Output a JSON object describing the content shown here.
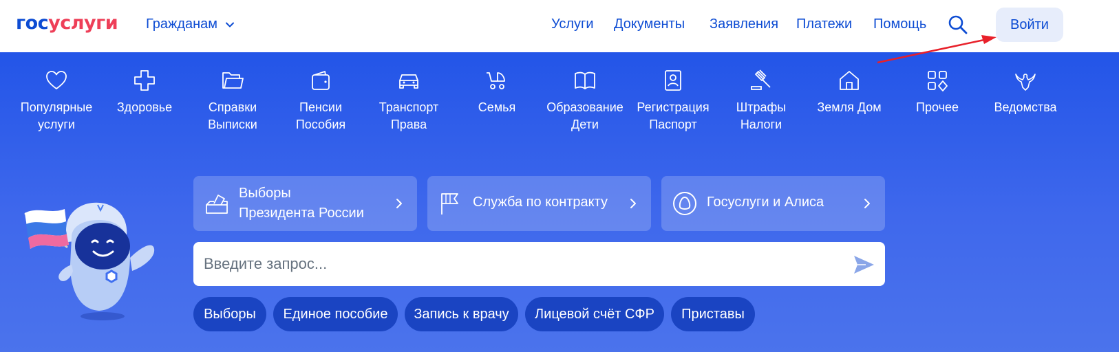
{
  "header": {
    "logo_part1": "гос",
    "logo_part2": "услуги",
    "audience": "Гражданам",
    "nav": [
      "Услуги",
      "Документы",
      "Заявления",
      "Платежи",
      "Помощь"
    ],
    "login": "Войти"
  },
  "categories": [
    {
      "label": "Популярные\nуслуги",
      "icon": "heart-icon"
    },
    {
      "label": "Здоровье",
      "icon": "cross-icon"
    },
    {
      "label": "Справки\nВыписки",
      "icon": "folder-icon"
    },
    {
      "label": "Пенсии\nПособия",
      "icon": "wallet-icon"
    },
    {
      "label": "Транспорт\nПрава",
      "icon": "car-icon"
    },
    {
      "label": "Семья",
      "icon": "stroller-icon"
    },
    {
      "label": "Образование\nДети",
      "icon": "book-icon"
    },
    {
      "label": "Регистрация\nПаспорт",
      "icon": "id-card-icon"
    },
    {
      "label": "Штрафы\nНалоги",
      "icon": "gavel-icon"
    },
    {
      "label": "Земля Дом",
      "icon": "house-icon"
    },
    {
      "label": "Прочее",
      "icon": "grid-icon"
    },
    {
      "label": "Ведомства",
      "icon": "eagle-icon"
    }
  ],
  "promos": [
    {
      "label": "Выборы\nПрезидента России",
      "icon": "ballot-box-icon"
    },
    {
      "label": "Служба по контракту",
      "icon": "flag-icon"
    },
    {
      "label": "Госуслуги и Алиса",
      "icon": "alice-icon"
    }
  ],
  "search": {
    "placeholder": "Введите запрос..."
  },
  "chips": [
    "Выборы",
    "Единое пособие",
    "Запись к врачу",
    "Лицевой счёт СФР",
    "Приставы"
  ],
  "colors": {
    "brand_blue": "#0d4cd3",
    "brand_red": "#ee3f58",
    "hero_blue": "#2355e8",
    "annotation_arrow": "#e8202a"
  }
}
